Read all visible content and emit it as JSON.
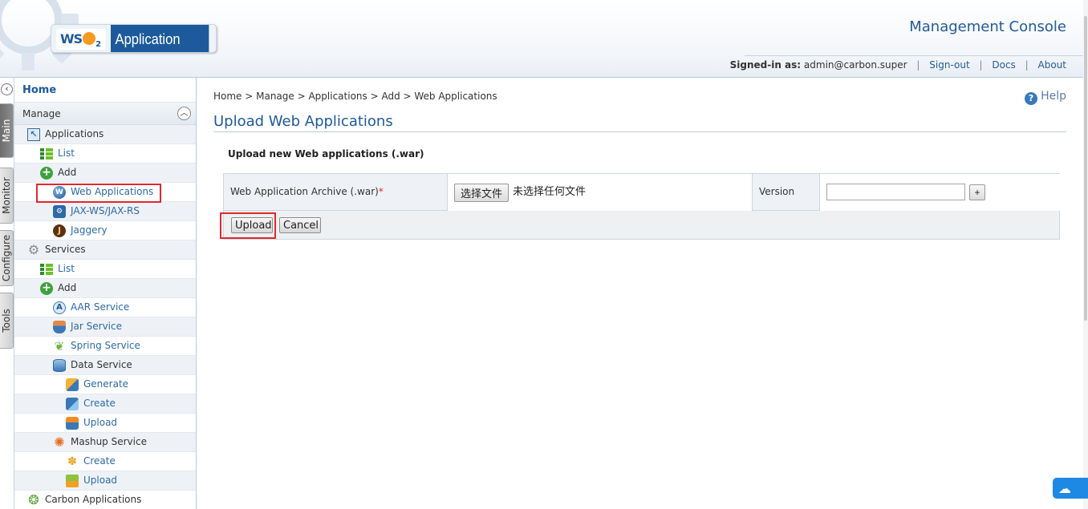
{
  "header": {
    "logo_text": "Application Server",
    "logo_brand": "WSO2",
    "console_title": "Management Console",
    "signed_in_label": "Signed-in as:",
    "signed_in_user": "admin@carbon.super",
    "links": [
      "Sign-out",
      "Docs",
      "About"
    ]
  },
  "vtabs": [
    "Main",
    "Monitor",
    "Configure",
    "Tools"
  ],
  "menu": {
    "home": "Home",
    "section": "Manage",
    "items": [
      {
        "label": "Applications",
        "icon": "applications-icon"
      },
      {
        "label": "List",
        "icon": "list-icon"
      },
      {
        "label": "Add",
        "icon": "add-icon"
      },
      {
        "label": "Web Applications",
        "icon": "web-applications-icon"
      },
      {
        "label": "JAX-WS/JAX-RS",
        "icon": "jax-ws-icon"
      },
      {
        "label": "Jaggery",
        "icon": "jaggery-icon"
      },
      {
        "label": "Services",
        "icon": "gear-icon"
      },
      {
        "label": "List",
        "icon": "list-icon"
      },
      {
        "label": "Add",
        "icon": "add-icon"
      },
      {
        "label": "AAR Service",
        "icon": "aar-service-icon"
      },
      {
        "label": "Jar Service",
        "icon": "jar-service-icon"
      },
      {
        "label": "Spring Service",
        "icon": "spring-leaf-icon"
      },
      {
        "label": "Data Service",
        "icon": "database-icon"
      },
      {
        "label": "Generate",
        "icon": "generate-icon"
      },
      {
        "label": "Create",
        "icon": "create-icon"
      },
      {
        "label": "Upload",
        "icon": "upload-icon"
      },
      {
        "label": "Mashup Service",
        "icon": "mashup-icon"
      },
      {
        "label": "Create",
        "icon": "create-icon"
      },
      {
        "label": "Upload",
        "icon": "upload-icon"
      },
      {
        "label": "Carbon Applications",
        "icon": "carbon-applications-icon"
      }
    ]
  },
  "content": {
    "breadcrumb": "Home > Manage > Applications > Add > Web Applications",
    "help": "Help",
    "page_title": "Upload Web Applications",
    "section_heading": "Upload new Web applications (.war)",
    "form": {
      "archive_label": "Web Application Archive (.war)",
      "required_marker": "*",
      "file_button": "选择文件",
      "file_status": "未选择任何文件",
      "version_label": "Version",
      "version_value": "",
      "add_version_button": "+"
    },
    "buttons": {
      "upload": "Upload",
      "cancel": "Cancel"
    }
  },
  "colors": {
    "brand_blue": "#1d5a9c",
    "link_blue": "#2d6aa8",
    "highlight_red": "#e0282e"
  }
}
